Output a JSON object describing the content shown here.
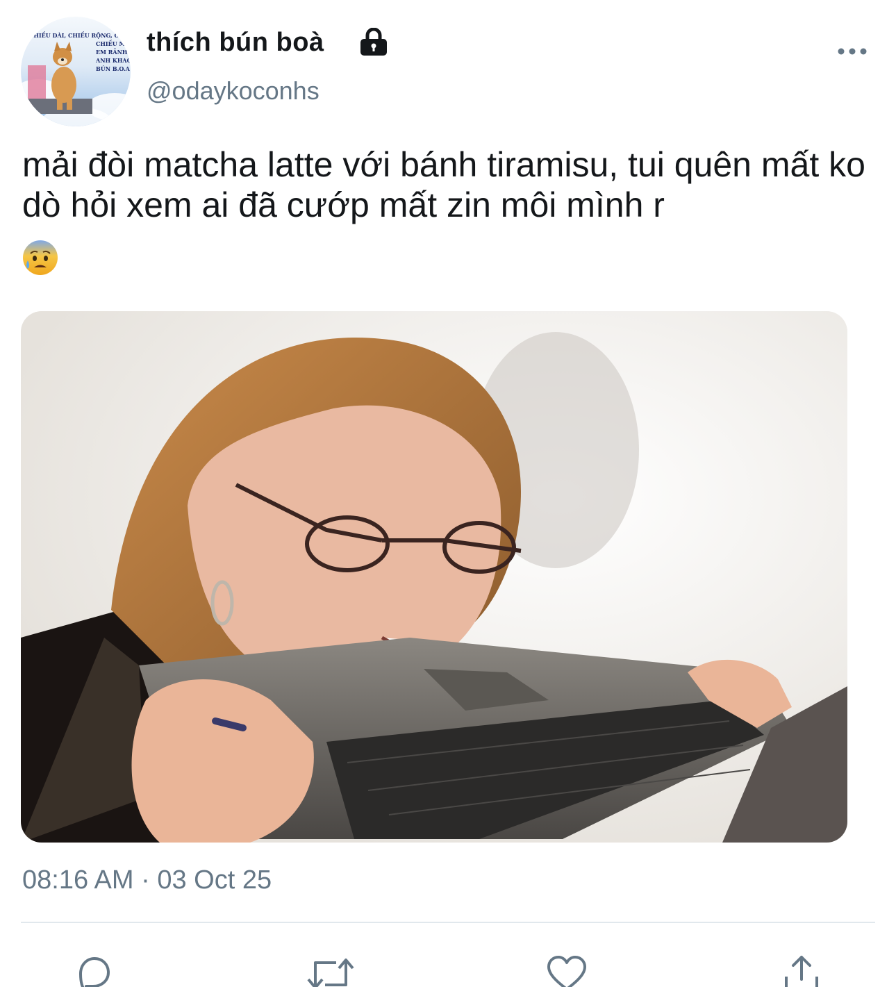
{
  "tweet": {
    "avatar_caption_lines": [
      "CHIỀU DÀI, CHIỀU RỘNG, CHIỀU C",
      "CHIỀU MA",
      "EM RẢNH?",
      "ANH KHAO",
      "BÚN B.O.A"
    ],
    "display_name": "thích bún boà",
    "protected_icon": "lock-icon",
    "handle": "@odaykoconhs",
    "more_icon": "more-horizontal-icon",
    "text": "mải đòi matcha latte với bánh tiramisu, tui quên mất ko dò hỏi xem ai đã cướp mất zin môi mình r",
    "emoji": "anxious-face-with-sweat",
    "media_description": "meme-photo-woman-biting-laptop",
    "timestamp": "08:16 AM · 03 Oct 25"
  },
  "actions": [
    {
      "name": "reply",
      "icon": "reply-icon"
    },
    {
      "name": "retweet",
      "icon": "retweet-icon"
    },
    {
      "name": "like",
      "icon": "heart-icon"
    },
    {
      "name": "share",
      "icon": "share-icon"
    }
  ],
  "colors": {
    "text_primary": "#14171a",
    "text_secondary": "#657786",
    "divider": "#e1e8ed"
  }
}
